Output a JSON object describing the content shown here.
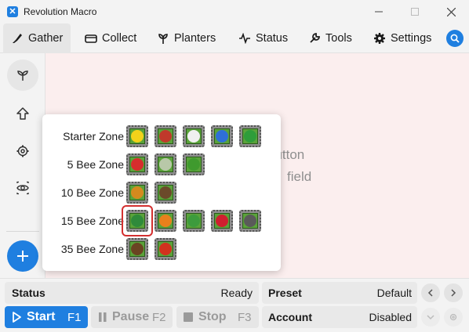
{
  "app": {
    "title": "Revolution Macro"
  },
  "tabs": [
    {
      "label": "Gather",
      "active": true
    },
    {
      "label": "Collect"
    },
    {
      "label": "Planters"
    },
    {
      "label": "Status"
    },
    {
      "label": "Tools"
    },
    {
      "label": "Settings"
    }
  ],
  "sidebar": {
    "items": [
      "sprout-icon",
      "arrow-up-icon",
      "gear-icon",
      "eye-icon"
    ]
  },
  "content": {
    "hint_line1": "button",
    "hint_line2": "field"
  },
  "field_picker": {
    "zones": [
      {
        "label": "Starter Zone",
        "fields": [
          "sunflower",
          "mushroom",
          "dandelion",
          "blue-flower",
          "clover"
        ]
      },
      {
        "label": "5 Bee Zone",
        "fields": [
          "strawberry",
          "spider",
          "bamboo"
        ]
      },
      {
        "label": "10 Bee Zone",
        "fields": [
          "pineapple",
          "stump"
        ]
      },
      {
        "label": "15 Bee Zone",
        "fields": [
          "cactus",
          "pumpkin",
          "pine-tree",
          "rose",
          "mountain-top"
        ],
        "selected_index": 0
      },
      {
        "label": "35 Bee Zone",
        "fields": [
          "coconut",
          "pepper"
        ]
      }
    ]
  },
  "status_bar": {
    "status_label": "Status",
    "status_value": "Ready",
    "preset_label": "Preset",
    "preset_value": "Default",
    "account_label": "Account",
    "account_value": "Disabled"
  },
  "controls": {
    "start_label": "Start",
    "start_key": "F1",
    "pause_label": "Pause",
    "pause_key": "F2",
    "stop_label": "Stop",
    "stop_key": "F3"
  },
  "colors": {
    "accent": "#1f7fe0",
    "content_bg": "#fbeeee",
    "selection": "#d32f2f"
  }
}
